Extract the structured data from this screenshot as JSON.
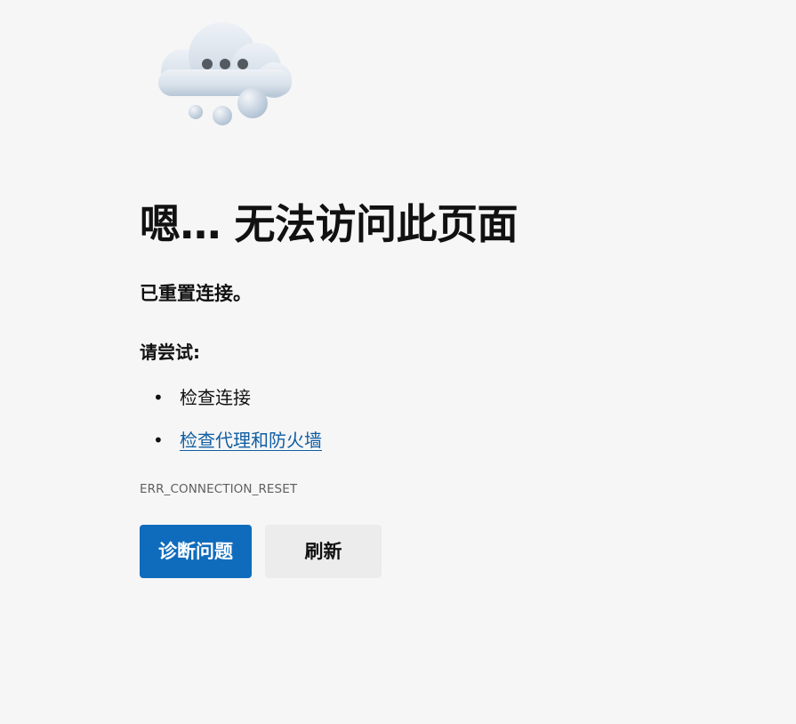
{
  "illustration": {
    "icon": "cloud-thinking-icon"
  },
  "error": {
    "title": "嗯… 无法访问此页面",
    "message": "已重置连接。",
    "try_heading": "请尝试:",
    "suggestions": [
      {
        "label": "检查连接",
        "is_link": false
      },
      {
        "label": "检查代理和防火墙",
        "is_link": true
      }
    ],
    "code": "ERR_CONNECTION_RESET"
  },
  "actions": {
    "diagnose_label": "诊断问题",
    "refresh_label": "刷新"
  },
  "colors": {
    "background": "#f6f6f6",
    "primary_button": "#0f6cbd",
    "secondary_button": "#ececec",
    "link": "#115ea3",
    "error_code_text": "#5f5f5f"
  }
}
